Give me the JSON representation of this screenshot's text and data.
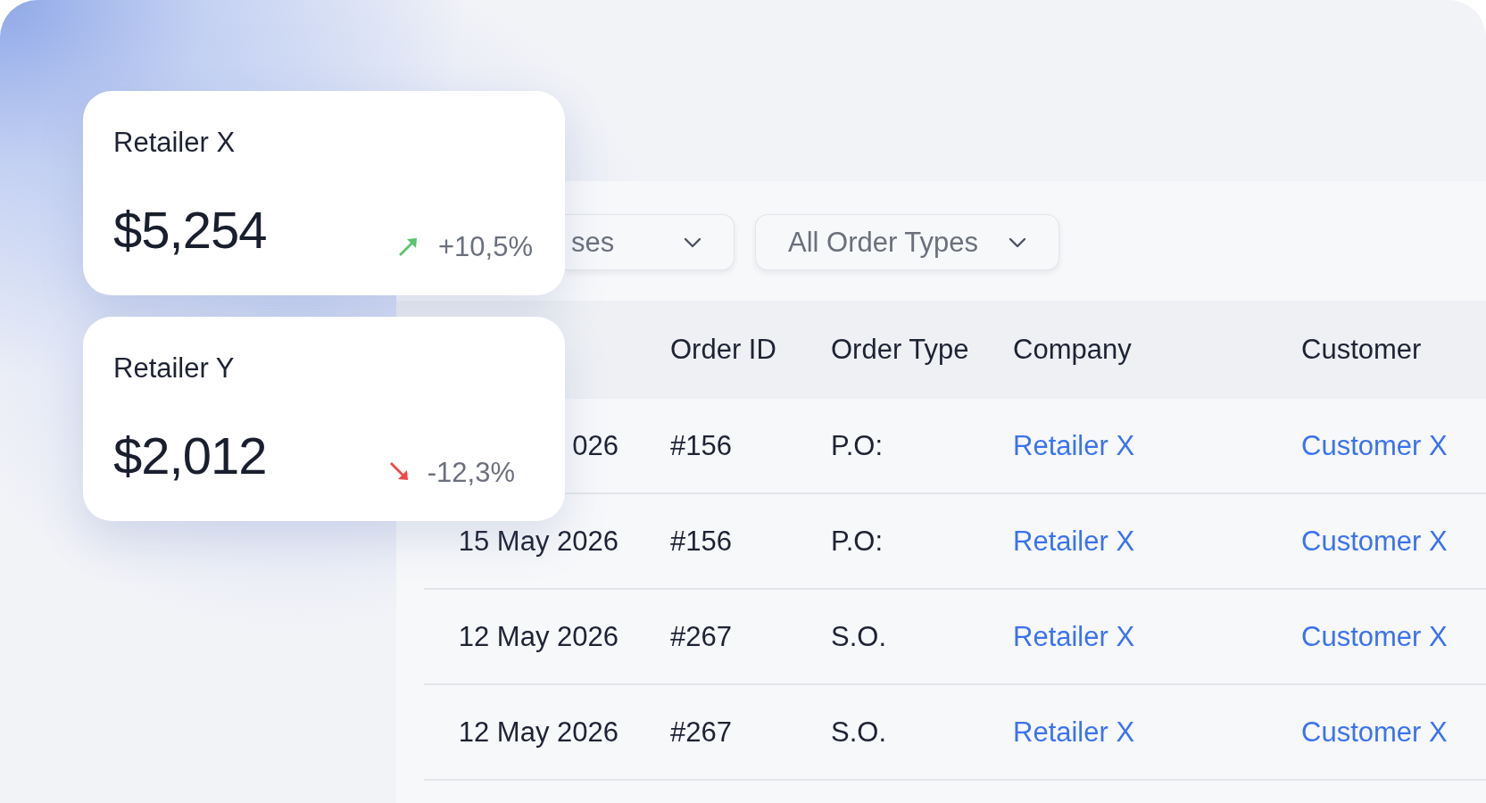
{
  "cards": [
    {
      "title": "Retailer X",
      "amount": "$5,254",
      "kind": "up",
      "change": "+10,5%"
    },
    {
      "title": "Retailer Y",
      "amount": "$2,012",
      "kind": "down",
      "change": "-12,3%"
    }
  ],
  "filters": [
    {
      "label": "ses"
    },
    {
      "label": "All Order Types"
    }
  ],
  "table": {
    "columns": [
      "",
      "Order ID",
      "Order Type",
      "Company",
      "Customer"
    ],
    "rows": [
      {
        "date": "026",
        "order_id": "#156",
        "order_type": "P.O:",
        "company": "Retailer X",
        "customer": "Customer X"
      },
      {
        "date": "15 May 2026",
        "order_id": "#156",
        "order_type": "P.O:",
        "company": "Retailer X",
        "customer": "Customer X"
      },
      {
        "date": "12 May 2026",
        "order_id": "#267",
        "order_type": "S.O.",
        "company": "Retailer X",
        "customer": "Customer X"
      },
      {
        "date": "12 May 2026",
        "order_id": "#267",
        "order_type": "S.O.",
        "company": "Retailer X",
        "customer": "Customer X"
      }
    ]
  }
}
